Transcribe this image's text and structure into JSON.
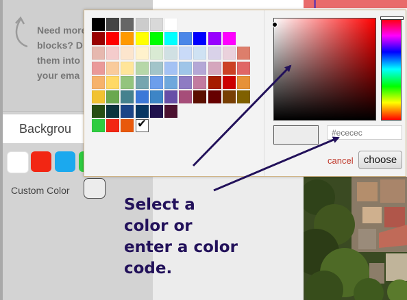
{
  "sidebar": {
    "help_text": "Need more\nblocks? D\nthem into\nyour ema",
    "background_tab_label": "Backgrou",
    "swatches": [
      "#ffffff",
      "#f22613",
      "#1ba9ee",
      "#2ecc40"
    ],
    "custom_color_label": "Custom Color",
    "custom_color_value": "#ececec"
  },
  "color_picker": {
    "palette": [
      [
        "#000000",
        "#444444",
        "#666666",
        "#cccccc",
        "#d9d9d9",
        "#ffffff"
      ],
      [
        "#990000",
        "#ff0000",
        "#ff9900",
        "#ffff00",
        "#00ff00",
        "#00ffff",
        "#4a86e8",
        "#0000ff",
        "#9900ff",
        "#ff00ff"
      ],
      [
        "#e6b8af",
        "#f4cccc",
        "#fce5cd",
        "#fff2cc",
        "#d9ead3",
        "#d0e0e3",
        "#c9daf8",
        "#cfe2f3",
        "#d9d2e9",
        "#ead1dc",
        "#dd7e6b"
      ],
      [
        "#ea9999",
        "#f9cb9c",
        "#ffe599",
        "#b6d7a8",
        "#a2c4c9",
        "#a4c2f4",
        "#9fc5e8",
        "#b4a7d6",
        "#d5a6bd",
        "#cc4125",
        "#e06666"
      ],
      [
        "#f6b26b",
        "#ffd966",
        "#93c47d",
        "#76a5af",
        "#6d9eeb",
        "#6fa8dc",
        "#8e7cc3",
        "#c27ba0",
        "#a61c00",
        "#cc0000",
        "#e69138"
      ],
      [
        "#f1c232",
        "#6aa84f",
        "#45818e",
        "#3c78d8",
        "#3d85c6",
        "#674ea7",
        "#a64d79",
        "#5b0f00",
        "#660000",
        "#783f04",
        "#7f6000"
      ],
      [
        "#274e13",
        "#0c343d",
        "#1c4587",
        "#073763",
        "#20124d",
        "#4c1130"
      ],
      [
        "#2ecc40",
        "#f22613",
        "#e8590c",
        "#ffffff"
      ]
    ],
    "selected_cell": [
      7,
      3
    ],
    "hue_color": "#ff0000",
    "preview_color": "#ececec",
    "hex_placeholder": "#ececec",
    "cancel_label": "cancel",
    "choose_label": "choose"
  },
  "annotation": {
    "text": "Select a\ncolor or\nenter a color\ncode.",
    "color": "#22115a"
  }
}
